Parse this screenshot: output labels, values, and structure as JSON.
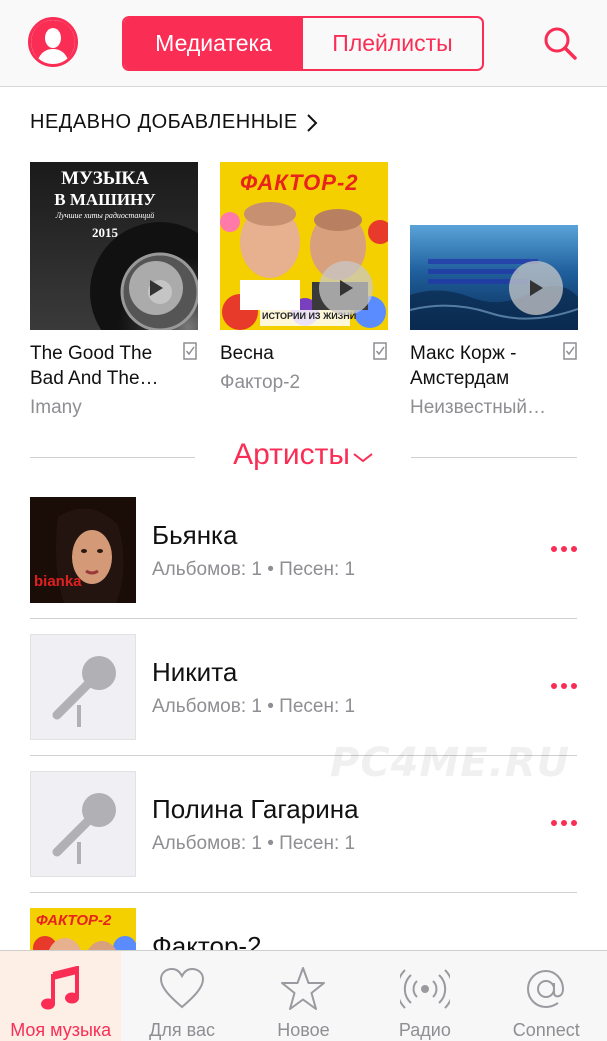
{
  "header": {
    "tabs": [
      {
        "label": "Медиатека",
        "active": true
      },
      {
        "label": "Плейлисты",
        "active": false
      }
    ],
    "accent_color": "#fa2d55"
  },
  "recently_added": {
    "title": "НЕДАВНО ДОБАВЛЕННЫЕ",
    "albums": [
      {
        "title": "The Good The Bad And The…",
        "artist": "Imany",
        "cover_text_1": "МУЗЫКА",
        "cover_text_2": "В МАШИНУ",
        "cover_text_3": "Лучшие хиты радиостанций",
        "cover_text_4": "2015"
      },
      {
        "title": "Весна",
        "artist": "Фактор-2",
        "cover_text_1": "ФАКТОР-2",
        "cover_text_2": "ИСТОРИИ ИЗ ЖИЗНИ"
      },
      {
        "title": "Макс Корж - Амстердам",
        "artist": "Неизвестный…"
      }
    ]
  },
  "artists_section": {
    "title": "Артисты",
    "items": [
      {
        "name": "Бьянка",
        "meta": "Альбомов: 1 • Песен: 1",
        "has_art": true,
        "art_text": "bianka"
      },
      {
        "name": "Никита",
        "meta": "Альбомов: 1 • Песен: 1",
        "has_art": false
      },
      {
        "name": "Полина Гагарина",
        "meta": "Альбомов: 1 • Песен: 1",
        "has_art": false
      },
      {
        "name": "Фактор-2",
        "meta": "",
        "has_art": true,
        "art_text": "ФАКТОР-2"
      }
    ]
  },
  "watermark": "PC4ME.RU",
  "tabbar": {
    "items": [
      {
        "label": "Моя музыка",
        "icon": "music-note-icon",
        "active": true
      },
      {
        "label": "Для вас",
        "icon": "heart-icon",
        "active": false
      },
      {
        "label": "Новое",
        "icon": "star-icon",
        "active": false
      },
      {
        "label": "Радио",
        "icon": "radio-icon",
        "active": false
      },
      {
        "label": "Connect",
        "icon": "at-sign-icon",
        "active": false
      }
    ]
  }
}
